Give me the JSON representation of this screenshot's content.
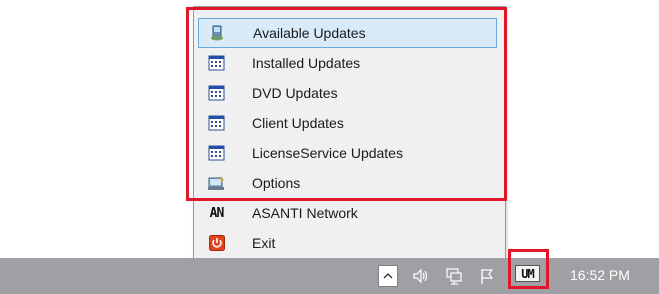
{
  "context_menu": {
    "items": [
      {
        "label": "Available Updates",
        "icon": "update-computer-icon",
        "selected": true
      },
      {
        "label": "Installed Updates",
        "icon": "window-list-icon"
      },
      {
        "label": "DVD Updates",
        "icon": "window-list-icon"
      },
      {
        "label": "Client Updates",
        "icon": "window-list-icon"
      },
      {
        "label": "LicenseService Updates",
        "icon": "window-list-icon"
      },
      {
        "label": "Options",
        "icon": "options-computer-icon"
      },
      {
        "label": "ASANTI Network",
        "icon": "asanti-network-icon"
      },
      {
        "label": "Exit",
        "icon": "exit-power-icon"
      }
    ]
  },
  "taskbar": {
    "tray_icons": [
      "show-hidden-icons-icon",
      "volume-icon",
      "network-icon",
      "action-center-flag-icon",
      "update-manager-icon"
    ],
    "update_manager_icon_text": "UM",
    "asanti_icon_text": "AN",
    "clock": "16:52 PM"
  },
  "colors": {
    "highlight_red": "#e0162b",
    "selection_fill": "#d9ebf9",
    "selection_border": "#6aa9dc",
    "taskbar": "#9ea0a3"
  }
}
